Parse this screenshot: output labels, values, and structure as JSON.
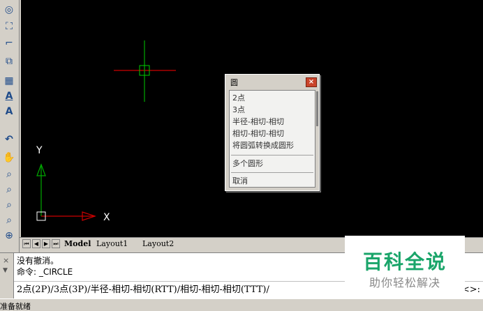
{
  "toolbar": {
    "tools": [
      {
        "icon": "circle-target-icon",
        "glyph": "◎"
      },
      {
        "icon": "rect-select-icon",
        "glyph": "⛶"
      },
      {
        "icon": "fillet-icon",
        "glyph": "⌐"
      },
      {
        "icon": "block-icon",
        "glyph": "⧉"
      },
      {
        "icon": "hatch-icon",
        "glyph": "▦"
      },
      {
        "icon": "text-underline-icon",
        "glyph": "A"
      },
      {
        "icon": "text-icon",
        "glyph": "A"
      },
      {
        "icon": "undo-icon",
        "glyph": "↶"
      },
      {
        "icon": "pan-hand-icon",
        "glyph": "✋"
      },
      {
        "icon": "zoom-realtime-icon",
        "glyph": "⌕"
      },
      {
        "icon": "zoom-window-icon",
        "glyph": "⌕"
      },
      {
        "icon": "zoom-previous-icon",
        "glyph": "⌕"
      },
      {
        "icon": "zoom-extents-icon",
        "glyph": "⌕"
      },
      {
        "icon": "zoom-in-icon",
        "glyph": "⊕"
      }
    ]
  },
  "canvas": {
    "background": "#000000",
    "ucs": {
      "y_label": "Y",
      "x_label": "X"
    },
    "crosshair_colors": {
      "horizontal": "#cc0000",
      "vertical": "#00aa00"
    }
  },
  "popup": {
    "title": "圆",
    "close_glyph": "×",
    "items": [
      "2点",
      "3点",
      "半径-相切-相切",
      "相切-相切-相切",
      "将圆弧转换成圆形",
      "多个圆形",
      "取消"
    ]
  },
  "tabs": {
    "nav": [
      "⏮",
      "◀",
      "▶",
      "⏭"
    ],
    "model": "Model",
    "layout1": "Layout1",
    "layout2": "Layout2"
  },
  "command": {
    "line1": "没有撤消。",
    "line2": "命令: _CIRCLE",
    "prompt": "2点(2P)/3点(3P)/半径-相切-相切(RTT)/相切-相切-相切(TTT)/",
    "prompt_tail": "<>:",
    "close_glyph": "×",
    "arrow_glyph": "▼"
  },
  "status": {
    "text": "准备就绪"
  },
  "watermark": {
    "title": "百科全说",
    "subtitle": "助你轻松解决",
    "color": "#1aa56a"
  }
}
